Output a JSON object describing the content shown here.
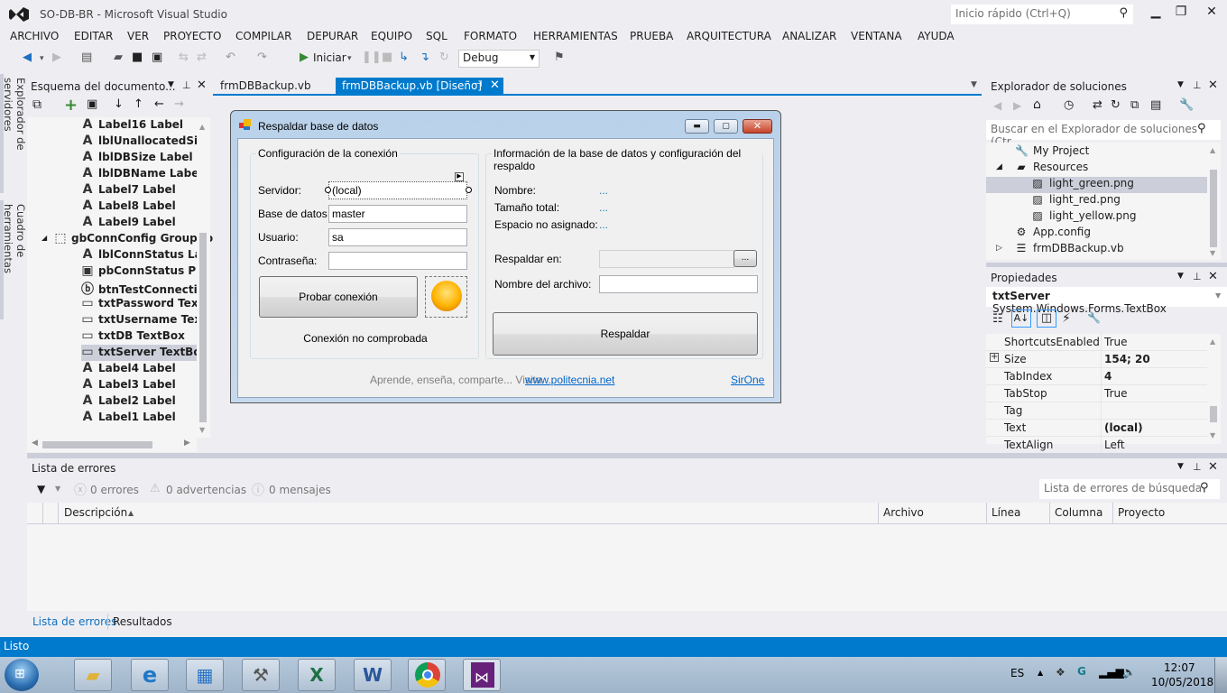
{
  "window": {
    "title": "SO-DB-BR - Microsoft Visual Studio",
    "quick_launch_placeholder": "Inicio rápido (Ctrl+Q)",
    "minimize": "▁",
    "restore": "❐",
    "close": "✕"
  },
  "menu": [
    "ARCHIVO",
    "EDITAR",
    "VER",
    "PROYECTO",
    "COMPILAR",
    "DEPURAR",
    "EQUIPO",
    "SQL",
    "FORMATO",
    "HERRAMIENTAS",
    "PRUEBA",
    "ARQUITECTURA",
    "ANALIZAR",
    "VENTANA",
    "AYUDA"
  ],
  "toolbar": {
    "start_label": "Iniciar",
    "configuration": "Debug"
  },
  "side_tabs": [
    "Explorador de servidores",
    "Cuadro de herramientas"
  ],
  "document_outline": {
    "title": "Esquema del documento...",
    "items": [
      {
        "icon": "label-icon",
        "text": "Label16  Label",
        "level": 2
      },
      {
        "icon": "label-icon",
        "text": "lblUnallocatedSize",
        "level": 2
      },
      {
        "icon": "label-icon",
        "text": "lblDBSize  Label",
        "level": 2
      },
      {
        "icon": "label-icon",
        "text": "lblDBName  Label",
        "level": 2
      },
      {
        "icon": "label-icon",
        "text": "Label7  Label",
        "level": 2
      },
      {
        "icon": "label-icon",
        "text": "Label8  Label",
        "level": 2
      },
      {
        "icon": "label-icon",
        "text": "Label9  Label",
        "level": 2
      },
      {
        "icon": "groupbox-icon",
        "text": "gbConnConfig  GroupBox",
        "level": 1,
        "expanded": true
      },
      {
        "icon": "label-icon",
        "text": "lblConnStatus  Label",
        "level": 2
      },
      {
        "icon": "picturebox-icon",
        "text": "pbConnStatus  PictureBox",
        "level": 2
      },
      {
        "icon": "button-icon",
        "text": "btnTestConnection",
        "level": 2
      },
      {
        "icon": "textbox-icon",
        "text": "txtPassword  TextBox",
        "level": 2
      },
      {
        "icon": "textbox-icon",
        "text": "txtUsername  TextBox",
        "level": 2
      },
      {
        "icon": "textbox-icon",
        "text": "txtDB  TextBox",
        "level": 2
      },
      {
        "icon": "textbox-icon",
        "text": "txtServer  TextBox",
        "level": 2,
        "selected": true
      },
      {
        "icon": "label-icon",
        "text": "Label4  Label",
        "level": 2
      },
      {
        "icon": "label-icon",
        "text": "Label3  Label",
        "level": 2
      },
      {
        "icon": "label-icon",
        "text": "Label2  Label",
        "level": 2
      },
      {
        "icon": "label-icon",
        "text": "Label1  Label",
        "level": 2
      }
    ]
  },
  "doc_tabs": [
    {
      "label": "frmDBBackup.vb",
      "active": false
    },
    {
      "label": "frmDBBackup.vb [Diseño]",
      "active": true
    }
  ],
  "form": {
    "title": "Respaldar base de datos",
    "conn_group": {
      "title": "Configuración de la conexión",
      "server_label": "Servidor:",
      "server_value": "(local)",
      "db_label": "Base de datos",
      "db_value": "master",
      "user_label": "Usuario:",
      "user_value": "sa",
      "password_label": "Contraseña:",
      "password_value": "",
      "test_button": "Probar conexión",
      "status": "Conexión no comprobada"
    },
    "info_group": {
      "title": "Información de la base de datos y configuración del respaldo",
      "name_label": "Nombre:",
      "name_value": "...",
      "size_label": "Tamaño total:",
      "size_value": "...",
      "unalloc_label": "Espacio no asignado:",
      "unalloc_value": "...",
      "backup_to_label": "Respaldar en:",
      "backup_to_value": "",
      "browse_button": "...",
      "filename_label": "Nombre del archivo:",
      "filename_value": "",
      "backup_button": "Respaldar"
    },
    "footer_text": "Aprende, enseña, comparte... Visita",
    "footer_link": "www.politecnia.net",
    "author_link": "SirOne"
  },
  "solution_explorer": {
    "title": "Explorador de soluciones",
    "search_placeholder": "Buscar en el Explorador de soluciones (Ctr",
    "items": [
      {
        "icon": "wrench-icon",
        "text": "My Project",
        "level": 1
      },
      {
        "icon": "folder-icon",
        "text": "Resources",
        "level": 1,
        "expanded": true
      },
      {
        "icon": "image-file-icon",
        "text": "light_green.png",
        "level": 2,
        "selected": true
      },
      {
        "icon": "image-file-icon",
        "text": "light_red.png",
        "level": 2
      },
      {
        "icon": "image-file-icon",
        "text": "light_yellow.png",
        "level": 2
      },
      {
        "icon": "config-file-icon",
        "text": "App.config",
        "level": 1
      },
      {
        "icon": "form-file-icon",
        "text": "frmDBBackup.vb",
        "level": 1,
        "collapsed": true
      }
    ]
  },
  "properties": {
    "title": "Propiedades",
    "object_name": "txtServer",
    "object_type": "System.Windows.Forms.TextBox",
    "rows": [
      {
        "name": "ShortcutsEnabled",
        "value": "True",
        "bold": false
      },
      {
        "name": "Size",
        "value": "154; 20",
        "bold": true,
        "expandable": true
      },
      {
        "name": "TabIndex",
        "value": "4",
        "bold": true
      },
      {
        "name": "TabStop",
        "value": "True",
        "bold": false
      },
      {
        "name": "Tag",
        "value": "",
        "bold": false
      },
      {
        "name": "Text",
        "value": "(local)",
        "bold": true
      },
      {
        "name": "TextAlign",
        "value": "Left",
        "bold": false
      }
    ]
  },
  "error_list": {
    "title": "Lista de errores",
    "errors": "0 errores",
    "warnings": "0 advertencias",
    "messages": "0 mensajes",
    "search_placeholder": "Lista de errores de búsqueda",
    "columns": [
      "Descripción",
      "Archivo",
      "Línea",
      "Columna",
      "Proyecto"
    ],
    "bottom_tabs": [
      "Lista de errores",
      "Resultados"
    ]
  },
  "status": "Listo",
  "taskbar": {
    "apps": [
      "start-button",
      "explorer",
      "internet-explorer",
      "control-panel",
      "tools",
      "excel",
      "word",
      "chrome",
      "visual-studio"
    ],
    "language": "ES",
    "time": "12:07",
    "date": "10/05/2018"
  }
}
